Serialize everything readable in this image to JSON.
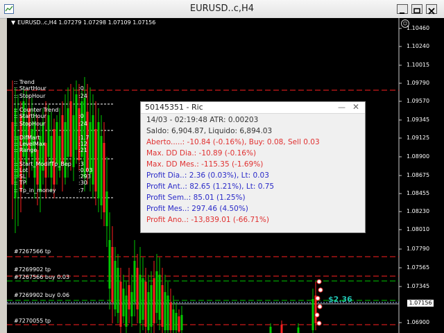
{
  "window": {
    "title": "EURUSD..c,H4"
  },
  "chart": {
    "header": "EURUSD..c,H4  1.07279 1.07298 1.07109 1.07156",
    "current_price": "1.07156",
    "price_scale": [
      "1.10460",
      "1.10240",
      "1.10015",
      "1.09790",
      "1.09570",
      "1.09345",
      "1.09125",
      "1.08900",
      "1.08675",
      "1.08455",
      "1.08230",
      "1.08010",
      "1.07790",
      "1.07565",
      "1.07345",
      "1.07156",
      "1.06900"
    ],
    "profit_label": "$2.36",
    "params": [
      {
        "label": ":: Trend",
        "value": ""
      },
      {
        "label": ":: StartHour",
        "value": ":0"
      },
      {
        "label": ":: StopHour",
        "value": ":24"
      },
      {
        "label": ":: Counter Trend",
        "value": ""
      },
      {
        "label": ":: StartHour",
        "value": ":0"
      },
      {
        "label": ":: StopHour",
        "value": ":24"
      },
      {
        "label": ":: DifMart",
        "value": ":1.7"
      },
      {
        "label": ":: LevelMax",
        "value": ":12"
      },
      {
        "label": ":: Range",
        "value": ":21"
      },
      {
        "label": ":: Start_ModifTp_Bep",
        "value": ":3"
      },
      {
        "label": ":: Lot",
        "value": ":0.03"
      },
      {
        "label": ":: SL",
        "value": ":293"
      },
      {
        "label": ":: TP",
        "value": ":30"
      },
      {
        "label": ":: Tp_in_money",
        "value": ":7"
      }
    ],
    "orders": [
      "#7267566 tp",
      "#7269902 tp",
      "#7267566 buy 0.03",
      "#7269902 buy 0.06",
      "#7270055 tp"
    ]
  },
  "panel": {
    "title": "50145351 - Ric",
    "minimize": "—",
    "close": "✕",
    "rows": [
      {
        "text": "14/03 - 02:19:48 ATR: 0.00203",
        "color": "#333333"
      },
      {
        "text": "Saldo: 6,904.87, Liquido: 6,894.03",
        "color": "#333333"
      },
      {
        "text": "Aberto.....: -10.84 (-0.16%), Buy: 0.08, Sell 0.03",
        "color": "#e03030"
      },
      {
        "text": "Max. DD Dia.: -10.89 (-0.16%)",
        "color": "#e03030"
      },
      {
        "text": "Max. DD Mes.: -115.35 (-1.69%)",
        "color": "#e03030"
      },
      {
        "text": "Profit Dia..: 2.36 (0.03%), Lt: 0.03",
        "color": "#2a2ac8"
      },
      {
        "text": "Profit Ant..: 82.65 (1.21%), Lt: 0.75",
        "color": "#2a2ac8"
      },
      {
        "text": "Profit Sem..: 85.01 (1.25%)",
        "color": "#2a2ac8"
      },
      {
        "text": "Profit Mes..: 297.46 (4.50%)",
        "color": "#2a2ac8"
      },
      {
        "text": "Profit Ano..: -13,839.01 (-66.71%)",
        "color": "#e03030"
      }
    ]
  },
  "colors": {
    "bull": "#00c800",
    "bear": "#ff2020",
    "tp_line": "#ff2020",
    "buy_line": "#00c800"
  }
}
